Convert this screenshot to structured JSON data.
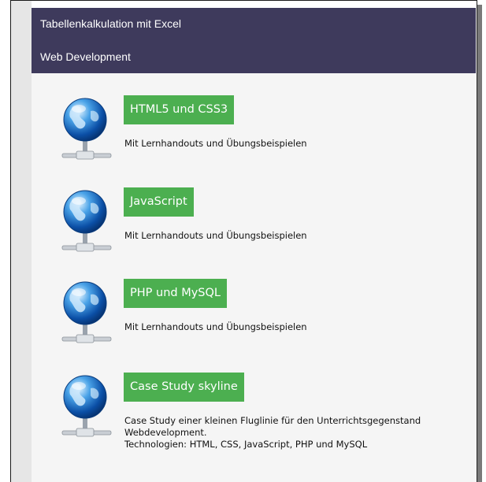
{
  "menu": {
    "items": [
      {
        "label": "Tabellenkalkulation mit Excel"
      },
      {
        "label": "Web Development"
      }
    ]
  },
  "colors": {
    "menu_bg": "#3e3a5c",
    "button_bg": "#4caf50",
    "content_bg": "#f5f5f5"
  },
  "courses": [
    {
      "title": "HTML5 und CSS3",
      "icon": "network-globe-icon",
      "description": [
        "Mit Lernhandouts und Übungsbeispielen"
      ]
    },
    {
      "title": "JavaScript",
      "icon": "network-globe-icon",
      "description": [
        "Mit Lernhandouts und Übungsbeispielen"
      ]
    },
    {
      "title": "PHP und MySQL",
      "icon": "network-globe-icon",
      "description": [
        "Mit Lernhandouts und Übungsbeispielen"
      ]
    },
    {
      "title": "Case Study skyline",
      "icon": "network-globe-icon",
      "description": [
        "Case Study einer kleinen Fluglinie für den Unterrichtsgegenstand",
        "Webdevelopment.",
        "Technologien: HTML, CSS, JavaScript, PHP und MySQL"
      ]
    }
  ]
}
